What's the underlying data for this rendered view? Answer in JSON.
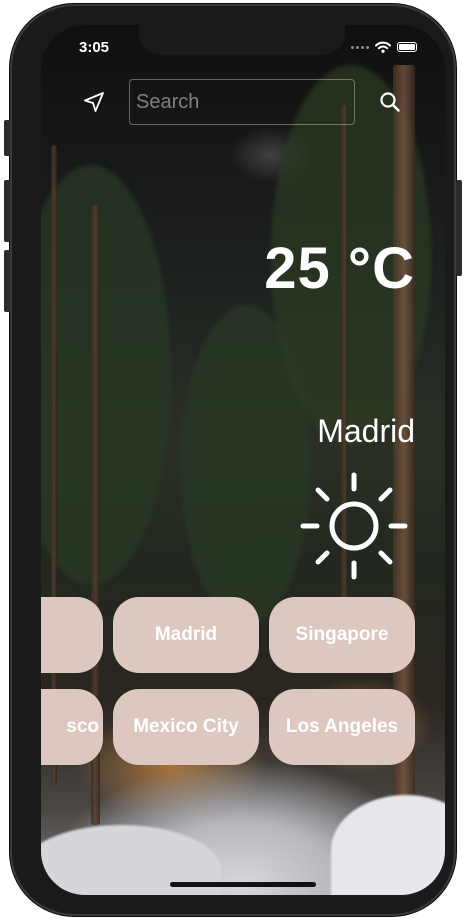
{
  "status_bar": {
    "time": "3:05"
  },
  "search": {
    "placeholder": "Search",
    "value": ""
  },
  "icons": {
    "location": "navigation-arrow-icon",
    "search": "search-icon",
    "weather": "sun-icon"
  },
  "weather": {
    "temperature": "25 °C",
    "city": "Madrid",
    "condition_icon": "sun-icon"
  },
  "city_chips": {
    "row1": [
      "Madrid",
      "Singapore"
    ],
    "row2": [
      "Mexico City",
      "Los Angeles"
    ],
    "partial_row1": "",
    "partial_row2": "sco"
  },
  "colors": {
    "chip_background": "#dcc8c0",
    "text": "#ffffff"
  }
}
